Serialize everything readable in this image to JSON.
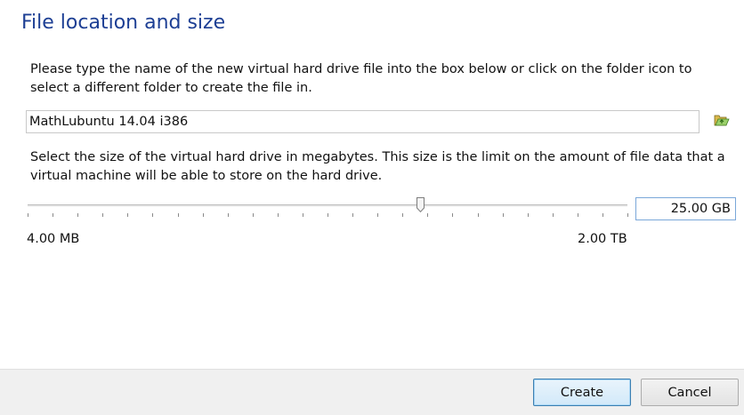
{
  "page": {
    "title": "File location and size",
    "location_description": "Please type the name of the new virtual hard drive file into the box below or click on the folder icon to select a different folder to create the file in.",
    "size_description": "Select the size of the virtual hard drive in megabytes. This size is the limit on the amount of file data that a virtual machine will be able to store on the hard drive."
  },
  "file": {
    "name": "MathLubuntu 14.04 i386",
    "folder_icon": "folder-open-icon"
  },
  "size": {
    "value": "25.00 GB",
    "min_label": "4.00 MB",
    "max_label": "2.00 TB",
    "slider_fraction": 0.655,
    "tick_count": 25
  },
  "buttons": {
    "create": "Create",
    "cancel": "Cancel"
  },
  "colors": {
    "title": "#1d3f94",
    "accent": "#3c7fb1",
    "folder": "#5ea83a"
  }
}
